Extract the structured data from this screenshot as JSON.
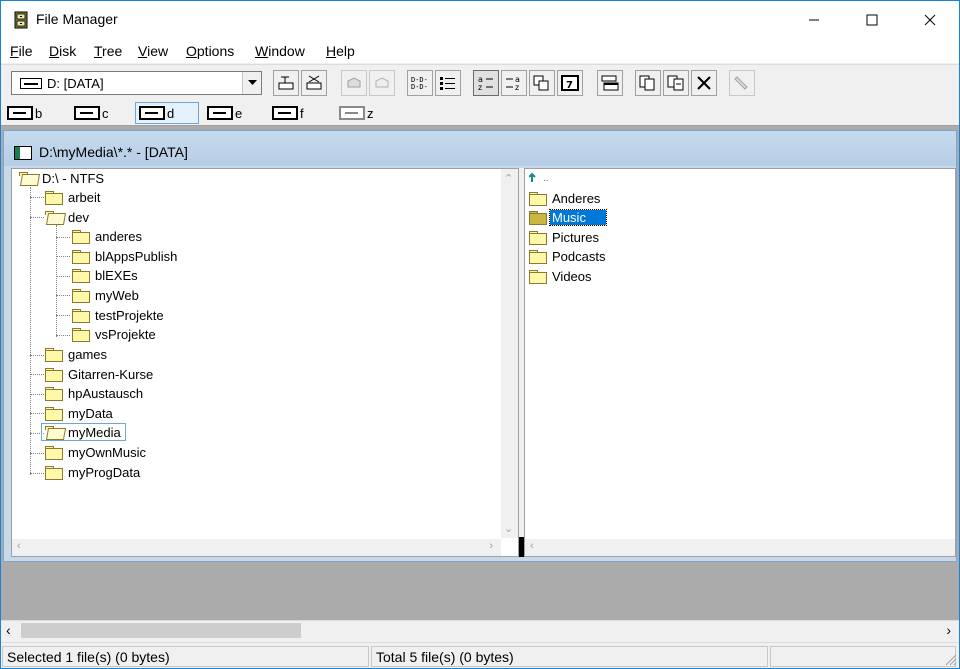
{
  "window": {
    "title": "File Manager",
    "icon": "file-cabinet-icon"
  },
  "menu": [
    {
      "label": "File",
      "underline": "F",
      "rest": "ile"
    },
    {
      "label": "Disk",
      "underline": "D",
      "rest": "isk"
    },
    {
      "label": "Tree",
      "underline": "T",
      "rest": "ree"
    },
    {
      "label": "View",
      "underline": "V",
      "rest": "iew"
    },
    {
      "label": "Options",
      "underline": "O",
      "rest": "ptions"
    },
    {
      "label": "Window",
      "underline": "W",
      "rest": "indow"
    },
    {
      "label": "Help",
      "underline": "H",
      "rest": "elp"
    }
  ],
  "toolbar": {
    "drive_select": "D: [DATA]"
  },
  "drives": [
    {
      "letter": "b"
    },
    {
      "letter": "c"
    },
    {
      "letter": "d",
      "active": true
    },
    {
      "letter": "e"
    },
    {
      "letter": "f"
    },
    {
      "letter": "z",
      "dim": true
    }
  ],
  "child_window": {
    "title": "D:\\myMedia\\*.* - [DATA]"
  },
  "tree": {
    "root": "D:\\ - NTFS",
    "items": [
      {
        "label": "arbeit",
        "level": 1
      },
      {
        "label": "dev",
        "level": 1
      },
      {
        "label": "anderes",
        "level": 2
      },
      {
        "label": "blAppsPublish",
        "level": 2
      },
      {
        "label": "blEXEs",
        "level": 2
      },
      {
        "label": "myWeb",
        "level": 2
      },
      {
        "label": "testProjekte",
        "level": 2
      },
      {
        "label": "vsProjekte",
        "level": 2
      },
      {
        "label": "games",
        "level": 1
      },
      {
        "label": "Gitarren-Kurse",
        "level": 1
      },
      {
        "label": "hpAustausch",
        "level": 1
      },
      {
        "label": "myData",
        "level": 1
      },
      {
        "label": "myMedia",
        "level": 1,
        "selected": true
      },
      {
        "label": "myOwnMusic",
        "level": 1
      },
      {
        "label": "myProgData",
        "level": 1
      }
    ]
  },
  "files": {
    "up_label": "..",
    "items": [
      {
        "label": "Anderes"
      },
      {
        "label": "Music",
        "selected": true
      },
      {
        "label": "Pictures"
      },
      {
        "label": "Podcasts"
      },
      {
        "label": "Videos"
      }
    ]
  },
  "status": {
    "selected": "Selected 1 file(s) (0 bytes)",
    "total": "Total 5 file(s) (0 bytes)"
  }
}
